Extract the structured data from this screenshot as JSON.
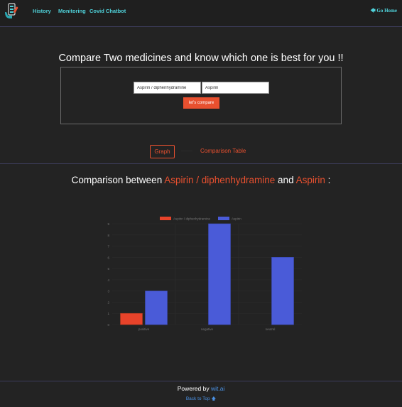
{
  "nav": {
    "logo_icon": "medicine-phone-icon",
    "links": [
      "History",
      "Monitoring",
      "Covid Chatbot"
    ],
    "go_home": "Go Home",
    "accent": "#4fd1d9"
  },
  "compare": {
    "headline": "Compare Two medicines and know which one is best for you !!",
    "medicine1_value": "Aspirin / diphenhydramine",
    "medicine2_value": "Aspirin",
    "button_label": "let's compare"
  },
  "tabs": {
    "graph": "Graph",
    "table": "Comparison Table"
  },
  "result": {
    "prefix": "Comparison between ",
    "med1": "Aspirin / diphenhydramine",
    "and": " and ",
    "med2": "Aspirin",
    "suffix": " :"
  },
  "chart_data": {
    "type": "bar",
    "categories": [
      "positive",
      "negative",
      "neutral"
    ],
    "series": [
      {
        "name": "Aspirin / diphenhydramine",
        "values": [
          1,
          0,
          0
        ],
        "color": "#e8432a"
      },
      {
        "name": "Aspirin",
        "values": [
          3,
          9,
          6
        ],
        "color": "#4a5bd8"
      }
    ],
    "ylim": [
      0,
      9
    ],
    "yticks": [
      "0",
      "1",
      "2",
      "3",
      "4",
      "5",
      "6",
      "7",
      "8",
      "9"
    ],
    "legend_position": "top",
    "grid": true
  },
  "footer": {
    "powered_prefix": "Powered by ",
    "powered_link": "wit.ai",
    "back_to_top": "Back to Top"
  }
}
